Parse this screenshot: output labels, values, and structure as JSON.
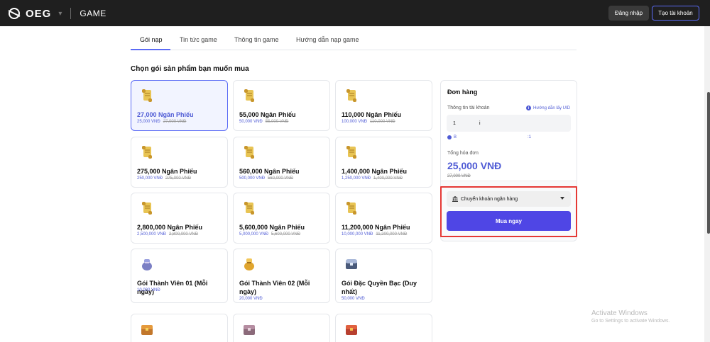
{
  "header": {
    "logo_text": "OEG",
    "logo_sep": "▾",
    "game_label": "GAME",
    "login_label": "Đăng nhập",
    "register_label": "Tạo tài khoản"
  },
  "tabs": [
    {
      "label": "Gói nạp"
    },
    {
      "label": "Tin tức game"
    },
    {
      "label": "Thông tin game"
    },
    {
      "label": "Hướng dẫn nạp game"
    }
  ],
  "section_title": "Chọn gói sản phẩm bạn muốn mua",
  "packages": [
    {
      "name": "27,000 Ngân Phiếu",
      "price": "25,000 VNĐ",
      "old_price": "27,000 VNĐ",
      "icon": "scroll-icon"
    },
    {
      "name": "55,000 Ngân Phiếu",
      "price": "50,000 VNĐ",
      "old_price": "55,000 VNĐ",
      "icon": "scroll-icon"
    },
    {
      "name": "110,000 Ngân Phiếu",
      "price": "100,000 VNĐ",
      "old_price": "110,000 VNĐ",
      "icon": "scroll-icon"
    },
    {
      "name": "275,000 Ngân Phiếu",
      "price": "250,000 VNĐ",
      "old_price": "275,000 VNĐ",
      "icon": "scroll-icon"
    },
    {
      "name": "560,000 Ngân Phiếu",
      "price": "500,000 VNĐ",
      "old_price": "560,000 VNĐ",
      "icon": "scroll-icon"
    },
    {
      "name": "1,400,000 Ngân Phiếu",
      "price": "1,250,000 VNĐ",
      "old_price": "1,400,000 VNĐ",
      "icon": "scroll-icon"
    },
    {
      "name": "2,800,000 Ngân Phiếu",
      "price": "2,500,000 VNĐ",
      "old_price": "2,800,000 VNĐ",
      "icon": "scroll-icon"
    },
    {
      "name": "5,600,000 Ngân Phiếu",
      "price": "5,000,000 VNĐ",
      "old_price": "5,600,000 VNĐ",
      "icon": "scroll-icon"
    },
    {
      "name": "11,200,000 Ngân Phiếu",
      "price": "10,000,000 VNĐ",
      "old_price": "11,200,000 VNĐ",
      "icon": "scroll-icon"
    },
    {
      "name": "Gói Thành Viên 01 (Mỗi ngày)",
      "price": "10,000 VNĐ",
      "icon": "pouch-icon"
    },
    {
      "name": "Gói Thành Viên 02 (Mỗi ngày)",
      "price": "20,000 VNĐ",
      "icon": "gold-pouch-icon"
    },
    {
      "name": "Gói Đặc Quyền Bạc (Duy nhất)",
      "price": "50,000 VNĐ",
      "icon": "silver-chest-icon"
    }
  ],
  "order": {
    "title": "Đơn hàng",
    "account_label": "Thông tin tài khoản",
    "uid_help": "Hướng dẫn lấy UID",
    "account_value_left": "1",
    "account_value_mid": "i",
    "status_left": "B",
    "status_right": ":1",
    "total_label": "Tổng hóa đơn",
    "total_value": "25,000 VNĐ",
    "total_old": "27,000 VNĐ",
    "payment_method": "Chuyển khoản ngân hàng",
    "buy_label": "Mua ngay"
  },
  "watermark": {
    "line1": "Activate Windows",
    "line2": "Go to Settings to activate Windows."
  },
  "colors": {
    "accent": "#4f46e5",
    "header_bg": "#1f1f1f",
    "highlight": "#e53935"
  }
}
